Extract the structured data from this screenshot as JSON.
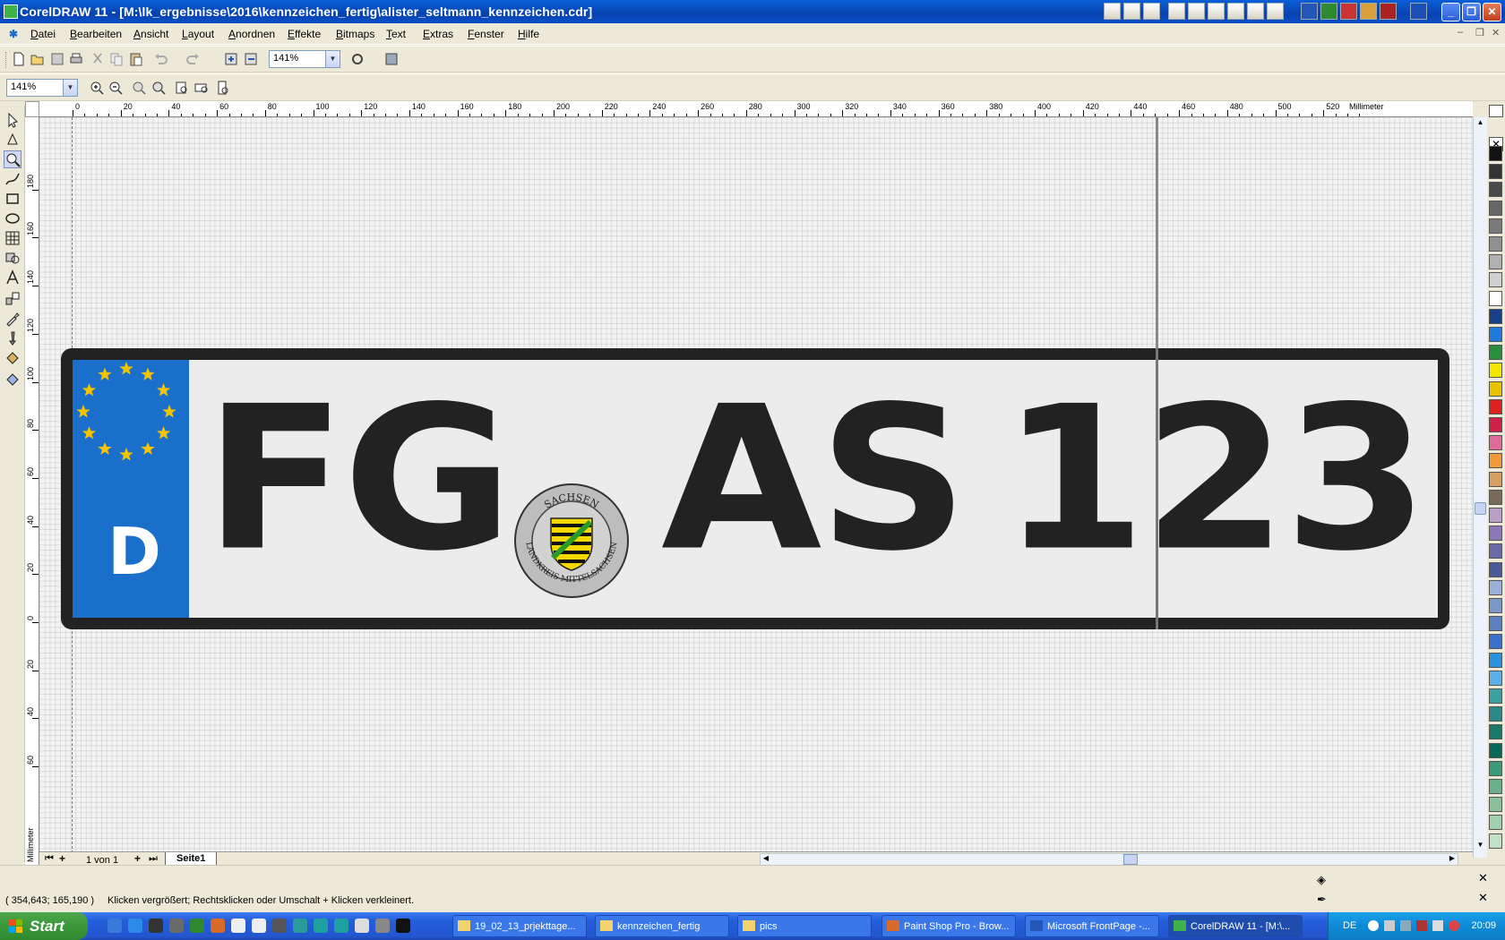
{
  "window": {
    "title": "CorelDRAW 11 - [M:\\lk_ergebnisse\\2016\\kennzeichen_fertig\\alister_seltmann_kennzeichen.cdr]"
  },
  "menu": [
    "Datei",
    "Bearbeiten",
    "Ansicht",
    "Layout",
    "Anordnen",
    "Effekte",
    "Bitmaps",
    "Text",
    "Extras",
    "Fenster",
    "Hilfe"
  ],
  "standard_toolbar": {
    "zoom_value": "141%"
  },
  "zoom_toolbar": {
    "zoom_value": "141%"
  },
  "ruler": {
    "unit": "Millimeter",
    "h_labels": [
      "0",
      "20",
      "40",
      "60",
      "80",
      "100",
      "120",
      "140",
      "160",
      "180",
      "200",
      "220",
      "240",
      "260",
      "280",
      "300",
      "320",
      "340",
      "360",
      "380",
      "400",
      "420",
      "440",
      "460",
      "480",
      "500",
      "520"
    ],
    "v_labels": [
      "180",
      "160",
      "140",
      "120",
      "100",
      "80",
      "60",
      "40",
      "20",
      "0",
      "20",
      "40",
      "60"
    ]
  },
  "plate": {
    "country_code": "D",
    "chars_left": "FG",
    "chars_right_1": "AS",
    "chars_right_2": "123",
    "seal_top_text": "SACHSEN",
    "seal_bottom_text": "LANDKREIS MITTELSACHSEN",
    "colors": {
      "eu_blue": "#1a6fca",
      "star_yellow": "#f5c400",
      "plate_black": "#222222",
      "plate_bg": "#ececec"
    }
  },
  "page_nav": {
    "page_of": "1 von 1",
    "page_tab": "Seite1"
  },
  "status": {
    "coords": "( 354,643; 165,190 )",
    "hint": "Klicken vergrößert; Rechtsklicken oder Umschalt + Klicken verkleinert."
  },
  "taskbar": {
    "start_label": "Start",
    "tasks": [
      {
        "label": "19_02_13_prjekttage...",
        "icon": "folder-icon"
      },
      {
        "label": "kennzeichen_fertig",
        "icon": "folder-icon"
      },
      {
        "label": "pics",
        "icon": "folder-icon"
      },
      {
        "label": "Paint Shop Pro - Brow...",
        "icon": "paintshop-icon"
      },
      {
        "label": "Microsoft FrontPage -...",
        "icon": "frontpage-icon"
      },
      {
        "label": "CorelDRAW 11 - [M:\\...",
        "icon": "coreldraw-icon"
      }
    ],
    "language": "DE",
    "clock": "20:09"
  }
}
